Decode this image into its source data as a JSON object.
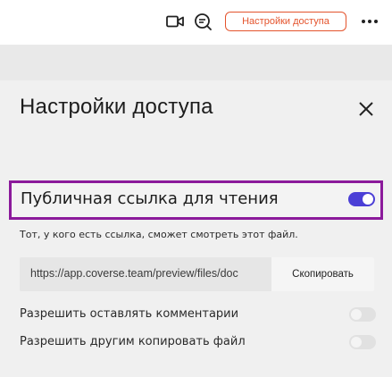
{
  "topbar": {
    "access_button_label": "Настройки доступа",
    "icons": [
      "video-icon",
      "comment-search-icon",
      "more-icon"
    ],
    "accent_color": "#e4532c"
  },
  "dialog": {
    "title": "Настройки доступа",
    "public_link": {
      "label": "Публичная ссылка для чтения",
      "enabled": true
    },
    "description": "Тот, у кого есть ссылка, сможет смотреть этот файл.",
    "link": {
      "url": "https://app.coverse.team/preview/files/doc",
      "copy_label": "Скопировать"
    },
    "options": [
      {
        "label": "Разрешить оставлять комментарии",
        "enabled": false
      },
      {
        "label": "Разрешить другим копировать файл",
        "enabled": false
      }
    ],
    "highlight_color": "#8b1a9b",
    "toggle_on_color": "#4b3fd6"
  }
}
